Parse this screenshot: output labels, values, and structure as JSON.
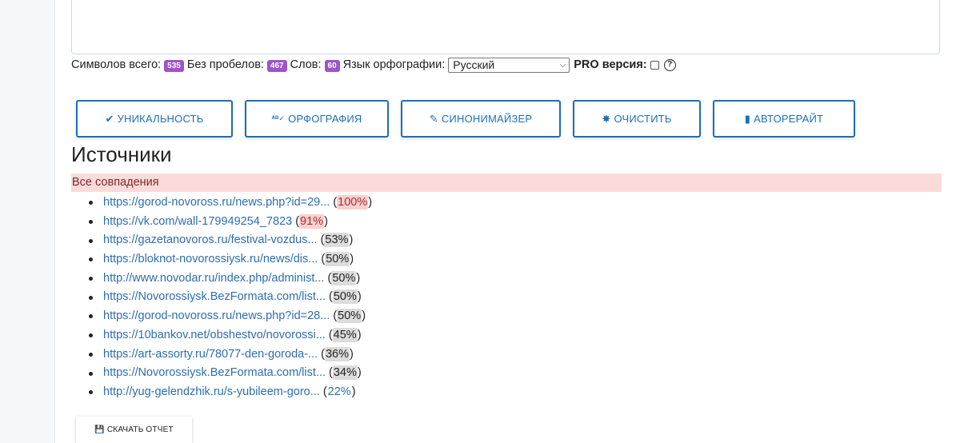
{
  "stats": {
    "chars_label": "Символов всего:",
    "chars_value": "535",
    "no_spaces_label": "Без пробелов:",
    "no_spaces_value": "467",
    "words_label": "Слов:",
    "words_value": "60",
    "lang_label": "Язык орфографии:",
    "lang_selected": "Русский",
    "pro_label": "PRO версия:"
  },
  "buttons": {
    "uniqueness": "УНИКАЛЬНОСТЬ",
    "spelling": "ОРФОГРАФИЯ",
    "synonymizer": "СИНОНИМАЙЗЕР",
    "clear": "ОЧИСТИТЬ",
    "autorewrite": "АВТОРЕРАЙТ"
  },
  "sources": {
    "title": "Источники",
    "all_matches_label": "Все совпадения",
    "items": [
      {
        "url": "https://gorod-novoross.ru/news.php?id=29...",
        "percent": "100%"
      },
      {
        "url": "https://vk.com/wall-179949254_7823",
        "percent": "91%"
      },
      {
        "url": "https://gazetanovoros.ru/festival-vozdus...",
        "percent": "53%"
      },
      {
        "url": "https://bloknot-novorossiysk.ru/news/dis...",
        "percent": "50%"
      },
      {
        "url": "http://www.novodar.ru/index.php/administ...",
        "percent": "50%"
      },
      {
        "url": "https://Novorossiysk.BezFormata.com/list...",
        "percent": "50%"
      },
      {
        "url": "https://gorod-novoross.ru/news.php?id=28...",
        "percent": "50%"
      },
      {
        "url": "https://10bankov.net/obshestvo/novorossi...",
        "percent": "45%"
      },
      {
        "url": "https://art-assorty.ru/78077-den-goroda-...",
        "percent": "36%"
      },
      {
        "url": "https://Novorossiysk.BezFormata.com/list...",
        "percent": "34%"
      },
      {
        "url": "http://yug-gelendzhik.ru/s-yubileem-goro...",
        "percent": "22%"
      }
    ]
  },
  "download_label": "СКАЧАТЬ ОТЧЕТ",
  "colors": {
    "accent": "#1b6fbf",
    "badge": "#9d54c8",
    "matches_bg": "#fbdada",
    "link": "#2d6db3"
  }
}
